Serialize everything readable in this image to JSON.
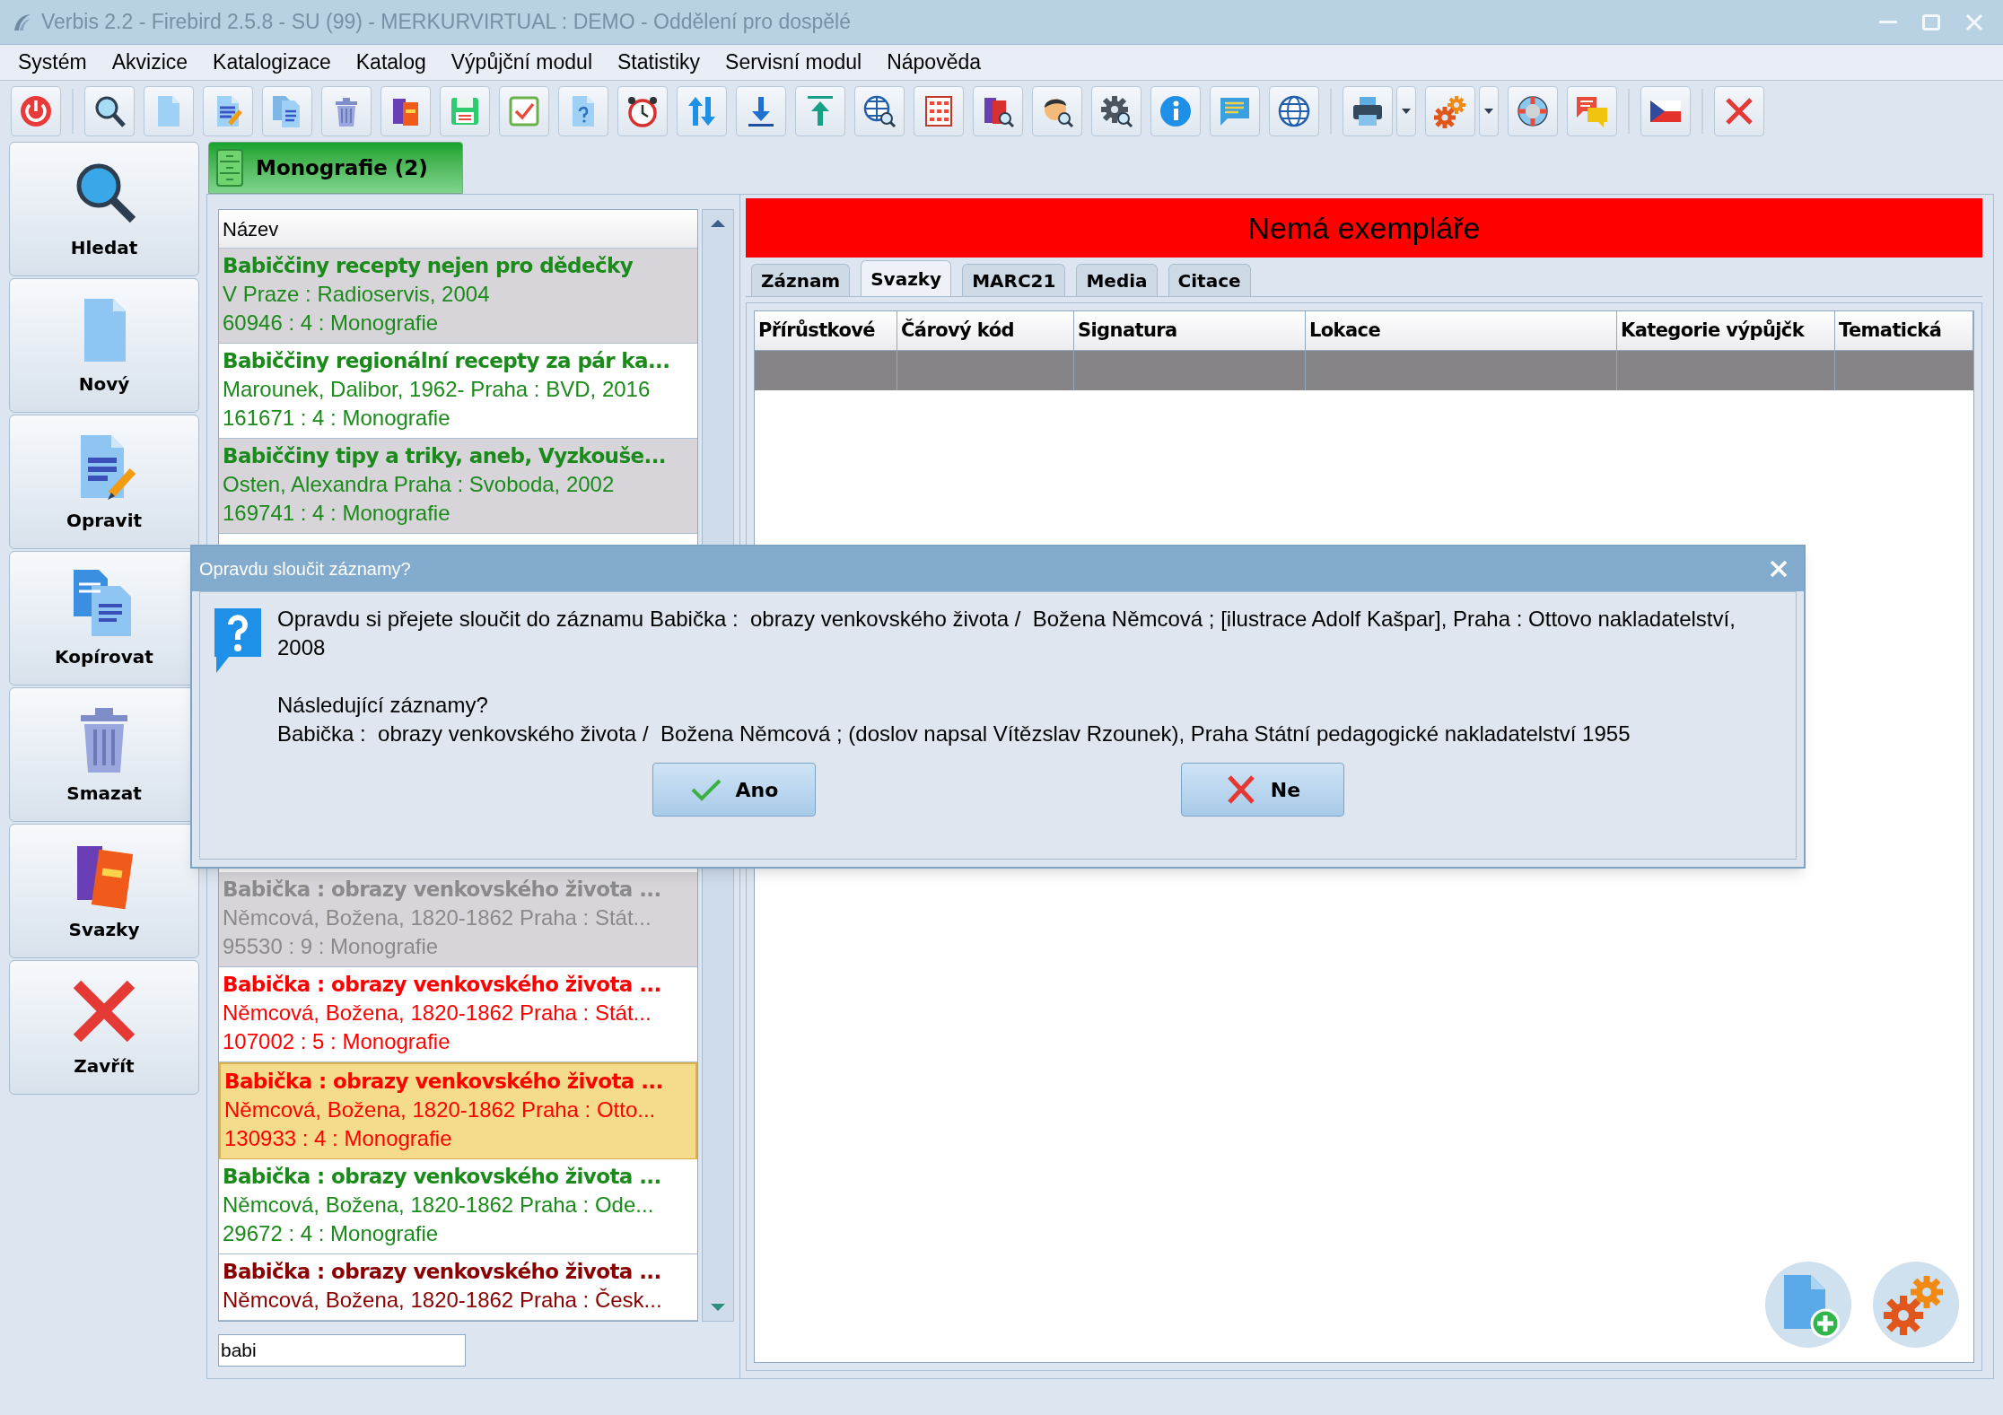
{
  "window": {
    "title": "Verbis 2.2 - Firebird 2.5.8 - SU (99) - MERKURVIRTUAL : DEMO - Oddělení pro dospělé"
  },
  "menu": [
    "Systém",
    "Akvizice",
    "Katalogizace",
    "Katalog",
    "Výpůjční modul",
    "Statistiky",
    "Servisní modul",
    "Nápověda"
  ],
  "sidebar": [
    "Hledat",
    "Nový",
    "Opravit",
    "Kopírovat",
    "Smazat",
    "Svazky",
    "Zavřít"
  ],
  "document_tab": {
    "label": "Monografie (2)",
    "selected": true
  },
  "list": {
    "header": "Název",
    "rows_above_dialog": [
      {
        "title": "Babiččiny recepty nejen pro dědečky",
        "author": "V Praze : Radioservis, 2004",
        "info": "60946 : 4 : Monografie",
        "color": "#1a8a1a",
        "shaded": true,
        "selected": false
      },
      {
        "title": "Babiččiny regionální recepty za pár ka...",
        "author": "Marounek, Dalibor, 1962- Praha : BVD, 2016",
        "info": "161671 : 4 : Monografie",
        "color": "#1a8a1a",
        "shaded": false,
        "selected": false
      },
      {
        "title": "Babiččiny tipy a triky, aneb, Vyzkouše...",
        "author": "Osten, Alexandra Praha : Svoboda, 2002",
        "info": "169741 : 4 : Monografie",
        "color": "#1a8a1a",
        "shaded": true,
        "selected": false
      }
    ],
    "rows_below_dialog": [
      {
        "title": "Babička : obrazy venkovského života ...",
        "author": "Němcová, Božena, 1820-1862 Praha : Stát...",
        "info": "95530 : 9 : Monografie",
        "color": "#8a8a8a",
        "shaded": true,
        "selected": false
      },
      {
        "title": "Babička : obrazy venkovského života ...",
        "author": "Němcová, Božena, 1820-1862 Praha : Stát...",
        "info": "107002 : 5 : Monografie",
        "color": "#ff0000",
        "shaded": false,
        "selected": false
      },
      {
        "title": "Babička : obrazy venkovského života ...",
        "author": "Němcová, Božena, 1820-1862 Praha : Otto...",
        "info": "130933 : 4 : Monografie",
        "color": "#ff0000",
        "shaded": false,
        "selected": true
      },
      {
        "title": "Babička : obrazy venkovského života ...",
        "author": "Němcová, Božena, 1820-1862 Praha : Ode...",
        "info": "29672 : 4 : Monografie",
        "color": "#1a8a1a",
        "shaded": false,
        "selected": false
      },
      {
        "title": "Babička : obrazy venkovského života ...",
        "author": "Němcová, Božena, 1820-1862 Praha : Česk...",
        "color": "#8b0000",
        "shaded": false,
        "selected": false
      }
    ],
    "search_value": "babi"
  },
  "detail": {
    "banner": "Nemá exempláře",
    "tabs": [
      {
        "label": "Záznam",
        "selected": false
      },
      {
        "label": "Svazky",
        "selected": true
      },
      {
        "label": "MARC21",
        "selected": false
      },
      {
        "label": "Media",
        "selected": false
      },
      {
        "label": "Citace",
        "selected": false
      }
    ],
    "columns": [
      "Přírůstkové",
      "Čárový kód",
      "Signatura",
      "Lokace",
      "Kategorie výpůjčk",
      "Tematická"
    ]
  },
  "dialog": {
    "title": "Opravdu sloučit záznamy?",
    "message": "Opravdu si přejete sloučit do záznamu Babička :  obrazy venkovského života /  Božena Němcová ; [ilustrace Adolf Kašpar], Praha : Ottovo nakladatelství, 2008",
    "question": "Následující záznamy?",
    "records": "Babička :  obrazy venkovského života /  Božena Němcová ; (doslov napsal Vítězslav Rzounek), Praha Státní pedagogické nakladatelství 1955",
    "buttons": [
      {
        "label": "Ano",
        "kind": "confirm"
      },
      {
        "label": "Ne",
        "kind": "cancel"
      }
    ]
  }
}
